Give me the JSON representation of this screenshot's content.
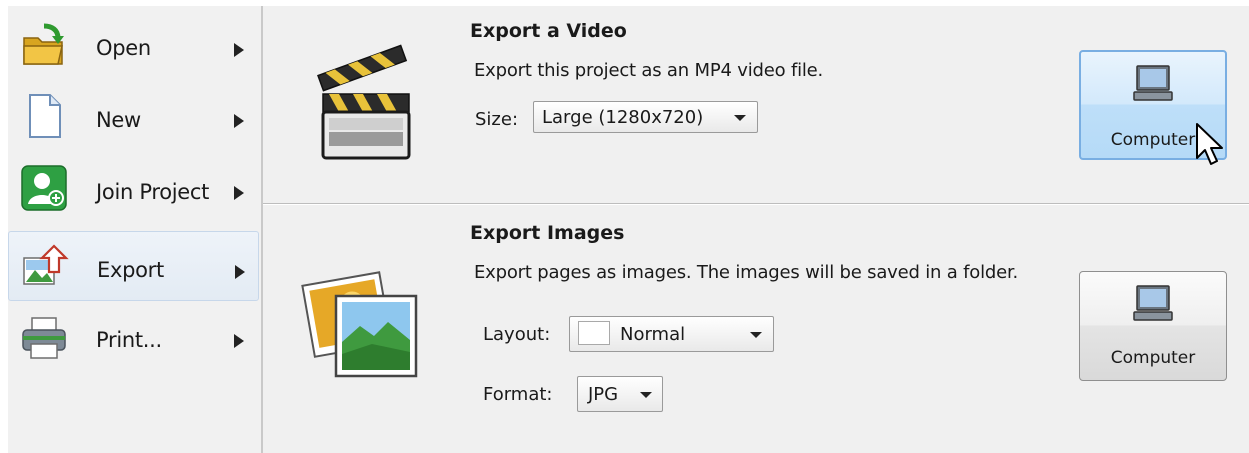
{
  "menu": {
    "items": [
      {
        "label": "Open",
        "icon": "open-folder-icon",
        "has_submenu": true,
        "selected": false
      },
      {
        "label": "New",
        "icon": "new-document-icon",
        "has_submenu": true,
        "selected": false
      },
      {
        "label": "Join Project",
        "icon": "join-project-icon",
        "has_submenu": true,
        "selected": false
      },
      {
        "label": "Export",
        "icon": "export-icon",
        "has_submenu": true,
        "selected": true
      },
      {
        "label": "Print...",
        "icon": "printer-icon",
        "has_submenu": true,
        "selected": false
      }
    ]
  },
  "export_video": {
    "title": "Export a Video",
    "description": "Export this project as an MP4 video file.",
    "size_label": "Size:",
    "size_value": "Large (1280x720)",
    "button_label": "Computer",
    "icon": "clapperboard-icon",
    "button_icon": "computer-icon"
  },
  "export_images": {
    "title": "Export Images",
    "description": "Export pages as images. The images will be saved in a folder.",
    "layout_label": "Layout:",
    "layout_value": "Normal",
    "format_label": "Format:",
    "format_value": "JPG",
    "button_label": "Computer",
    "icon": "photos-icon",
    "button_icon": "computer-icon"
  },
  "colors": {
    "accent_hover": "#79aee2",
    "selected_bg": "#e3ebf4",
    "panel_bg": "#f0f0f0"
  }
}
